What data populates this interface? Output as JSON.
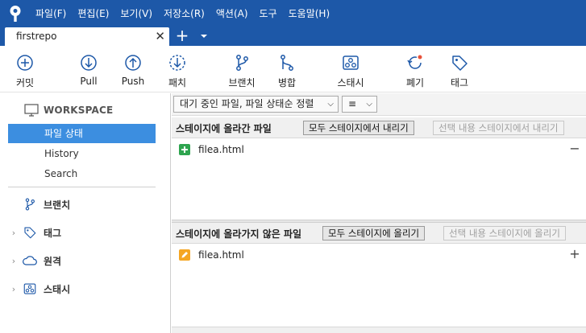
{
  "menu": {
    "items": [
      "파일(F)",
      "편집(E)",
      "보기(V)",
      "저장소(R)",
      "액션(A)",
      "도구",
      "도움말(H)"
    ]
  },
  "tab": {
    "title": "firstrepo",
    "close": "✕",
    "add": "+"
  },
  "toolbar": {
    "commit": "커밋",
    "pull": "Pull",
    "push": "Push",
    "patch": "패치",
    "branch": "브랜치",
    "merge": "병합",
    "stash": "스태시",
    "discard": "폐기",
    "tag": "태그"
  },
  "sidebar": {
    "workspace": "WORKSPACE",
    "file_status": "파일 상태",
    "history": "History",
    "search": "Search",
    "branches": "브랜치",
    "tags": "태그",
    "remotes": "원격",
    "stashes": "스태시"
  },
  "filter": {
    "mode": "대기 중인 파일, 파일 상태순 정렬",
    "view_icon": "≡"
  },
  "staged": {
    "title": "스테이지에 올라간 파일",
    "unstage_all": "모두 스테이지에서 내리기",
    "unstage_selected": "선택 내용 스테이지에서 내리기",
    "files": [
      {
        "name": "filea.html",
        "status": "added"
      }
    ],
    "row_action": "−"
  },
  "unstaged": {
    "title": "스테이지에 올라가지 않은 파일",
    "stage_all": "모두 스테이지에 올리기",
    "stage_selected": "선택 내용 스테이지에 올리기",
    "files": [
      {
        "name": "filea.html",
        "status": "modified"
      }
    ],
    "row_action": "+"
  },
  "colors": {
    "accent": "#1d58a8",
    "selection": "#3c8ee0",
    "added": "#2ea44f",
    "modified": "#f5a623",
    "discard_dot": "#e8523a"
  }
}
